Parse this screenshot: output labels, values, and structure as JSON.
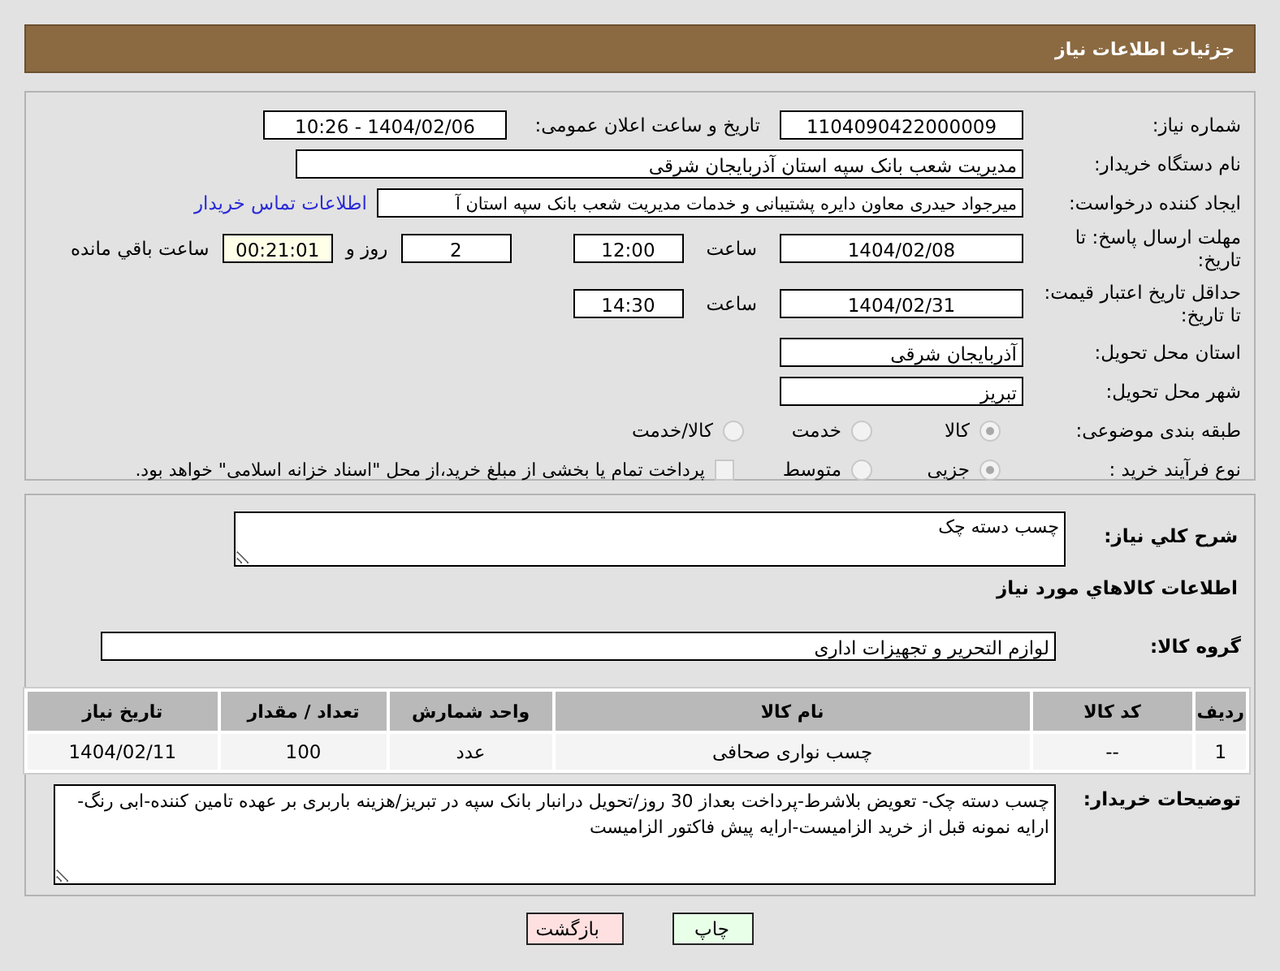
{
  "header": {
    "title": "جزئیات اطلاعات نیاز"
  },
  "form": {
    "need_number": {
      "label": "شماره نیاز:",
      "value": "1104090422000009"
    },
    "announce": {
      "label": "تاریخ و ساعت اعلان عمومی:",
      "value": "1404/02/06 - 10:26"
    },
    "buyer": {
      "label": "نام دستگاه خریدار:",
      "value": "مدیریت شعب بانک سپه استان آذربایجان شرقی"
    },
    "creator": {
      "label": "ایجاد کننده درخواست:",
      "value": "میرجواد حیدری معاون دایره پشتیبانی و خدمات مدیریت شعب بانک سپه استان آ",
      "link": "اطلاعات تماس خریدار"
    },
    "deadline": {
      "label": "مهلت ارسال پاسخ: تا تاریخ:",
      "date": "1404/02/08",
      "time_label": "ساعت",
      "time": "12:00",
      "days": "2",
      "days_label": "روز و",
      "remaining": "00:21:01",
      "remaining_label": "ساعت باقي مانده"
    },
    "validity": {
      "label": "حداقل تاریخ اعتبار قیمت: تا تاریخ:",
      "date": "1404/02/31",
      "time_label": "ساعت",
      "time": "14:30"
    },
    "province": {
      "label": "استان محل تحویل:",
      "value": "آذربایجان شرقی"
    },
    "city": {
      "label": "شهر محل تحویل:",
      "value": "تبریز"
    },
    "category": {
      "label": "طبقه بندی موضوعی:",
      "options": [
        {
          "label": "كالا",
          "selected": true
        },
        {
          "label": "خدمت",
          "selected": false
        },
        {
          "label": "كالا/خدمت",
          "selected": false
        }
      ]
    },
    "process": {
      "label": "نوع فرآیند خرید :",
      "options": [
        {
          "label": "جزیی",
          "selected": true
        },
        {
          "label": "متوسط",
          "selected": false
        }
      ],
      "payment": {
        "checked": false,
        "text": "پرداخت تمام یا بخشی از مبلغ خرید،از محل \"اسناد خزانه اسلامی\" خواهد بود."
      }
    }
  },
  "summary": {
    "label": "شرح كلي نياز:",
    "value": "چسب دسته چک"
  },
  "goods_title": "اطلاعات كالاهاي مورد نياز",
  "goods_group": {
    "label": "گروه کالا:",
    "value": "لوازم التحریر و تجهیزات اداری"
  },
  "table": {
    "columns": [
      "ردیف",
      "کد کالا",
      "نام کالا",
      "واحد شمارش",
      "تعداد / مقدار",
      "تاریخ نیاز"
    ],
    "rows": [
      [
        "1",
        "--",
        "چسب نواری صحافی",
        "عدد",
        "100",
        "1404/02/11"
      ]
    ]
  },
  "notes": {
    "label": "توضیحات خریدار:",
    "value": "چسب دسته چک- تعویض بلاشرط-پرداخت بعداز 30 روز/تحویل درانبار بانک سپه در تبریز/هزینه باربری بر عهده تامین کننده-ابی رنگ-ارایه نمونه قبل از خرید الزامیست-ارایه پیش فاکتور الزامیست"
  },
  "buttons": [
    {
      "label": "چاپ",
      "kind": "print"
    },
    {
      "label": "بازگشت",
      "kind": "back"
    }
  ]
}
